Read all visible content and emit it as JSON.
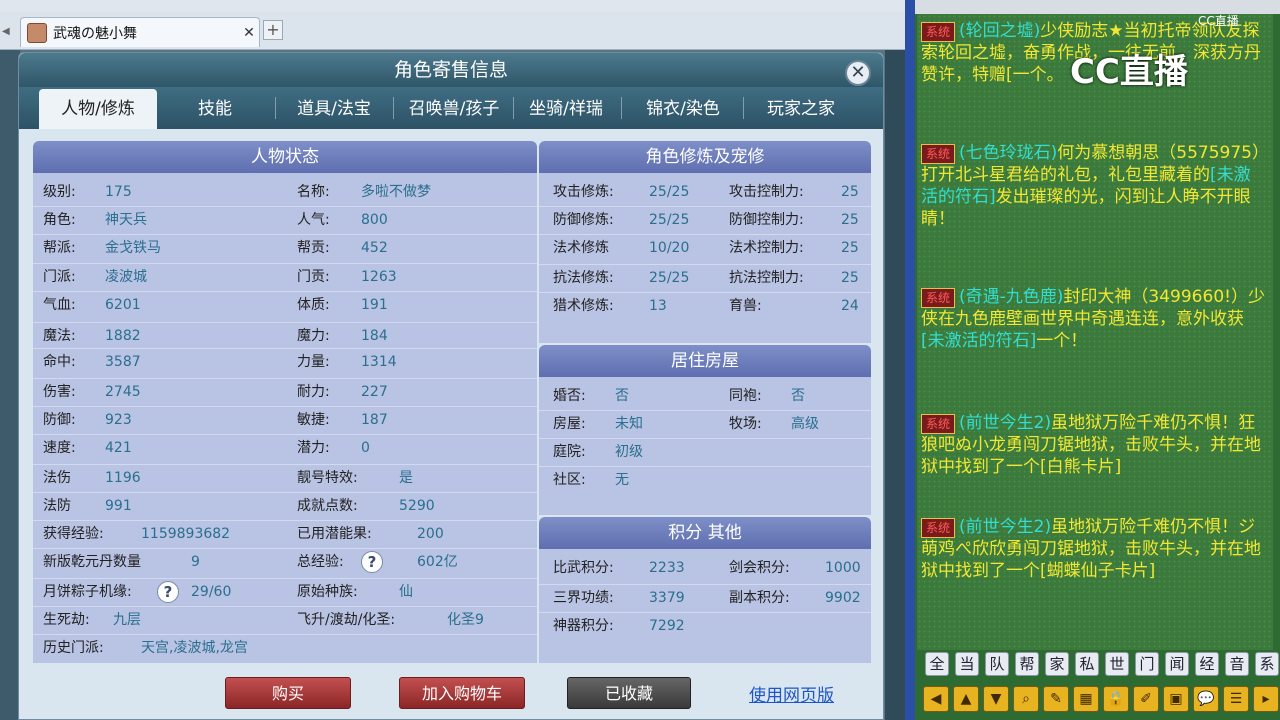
{
  "browser": {
    "tab_title": "武魂の魅小舞",
    "tab_close": "✕",
    "tab_add": "+"
  },
  "dialog": {
    "title": "角色寄售信息",
    "close": "✕",
    "tabs": [
      "人物/修炼",
      "技能",
      "道具/法宝",
      "召唤兽/孩子",
      "坐骑/祥瑞",
      "锦衣/染色",
      "玩家之家"
    ],
    "active_tab": "人物/修炼"
  },
  "status": {
    "header": "人物状态",
    "left": [
      {
        "label": "级别:",
        "value": "175"
      },
      {
        "label": "角色:",
        "value": "神天兵"
      },
      {
        "label": "帮派:",
        "value": "金戈铁马"
      },
      {
        "label": "门派:",
        "value": "凌波城"
      },
      {
        "label": "气血:",
        "value": "6201"
      },
      {
        "label": "魔法:",
        "value": "1882"
      },
      {
        "label": "命中:",
        "value": "3587"
      },
      {
        "label": "伤害:",
        "value": "2745"
      },
      {
        "label": "防御:",
        "value": "923"
      },
      {
        "label": "速度:",
        "value": "421"
      },
      {
        "label": "法伤",
        "value": "1196"
      },
      {
        "label": "法防",
        "value": "991"
      },
      {
        "label": "获得经验:",
        "value": "1159893682"
      },
      {
        "label": "新版乾元丹数量",
        "value": "9"
      },
      {
        "label": "月饼粽子机缘:",
        "value": "29/60"
      },
      {
        "label": "生死劫:",
        "value": "九层"
      },
      {
        "label": "历史门派:",
        "value": "天宫,凌波城,龙宫"
      }
    ],
    "right": [
      {
        "label": "名称:",
        "value": "多啦不做梦"
      },
      {
        "label": "人气:",
        "value": "800"
      },
      {
        "label": "帮贡:",
        "value": "452"
      },
      {
        "label": "门贡:",
        "value": "1263"
      },
      {
        "label": "体质:",
        "value": "191"
      },
      {
        "label": "魔力:",
        "value": "184"
      },
      {
        "label": "力量:",
        "value": "1314"
      },
      {
        "label": "耐力:",
        "value": "227"
      },
      {
        "label": "敏捷:",
        "value": "187"
      },
      {
        "label": "潜力:",
        "value": "0"
      },
      {
        "label": "靓号特效:",
        "value": "是"
      },
      {
        "label": "成就点数:",
        "value": "5290"
      },
      {
        "label": "已用潜能果:",
        "value": "200"
      },
      {
        "label": "总经验:",
        "value": "602亿"
      },
      {
        "label": "原始种族:",
        "value": "仙"
      },
      {
        "label": "飞升/渡劫/化圣:",
        "value": "化圣9"
      }
    ],
    "help": "?"
  },
  "cultivation": {
    "header": "角色修炼及宠修",
    "rows": [
      {
        "l1": "攻击修炼:",
        "v1": "25/25",
        "l2": "攻击控制力:",
        "v2": "25"
      },
      {
        "l1": "防御修炼:",
        "v1": "25/25",
        "l2": "防御控制力:",
        "v2": "25"
      },
      {
        "l1": "法术修炼",
        "v1": "10/20",
        "l2": "法术控制力:",
        "v2": "25"
      },
      {
        "l1": "抗法修炼:",
        "v1": "25/25",
        "l2": "抗法控制力:",
        "v2": "25"
      },
      {
        "l1": "猎术修炼:",
        "v1": "13",
        "l2": "育兽:",
        "v2": "24"
      }
    ]
  },
  "housing": {
    "header": "居住房屋",
    "rows": [
      {
        "l1": "婚否:",
        "v1": "否",
        "l2": "同袍:",
        "v2": "否"
      },
      {
        "l1": "房屋:",
        "v1": "未知",
        "l2": "牧场:",
        "v2": "高级"
      },
      {
        "l1": "庭院:",
        "v1": "初级",
        "l2": "",
        "v2": ""
      },
      {
        "l1": "社区:",
        "v1": "无",
        "l2": "",
        "v2": ""
      }
    ]
  },
  "points": {
    "header": "积分 其他",
    "rows": [
      {
        "l1": "比武积分:",
        "v1": "2233",
        "l2": "剑会积分:",
        "v2": "1000"
      },
      {
        "l1": "三界功绩:",
        "v1": "3379",
        "l2": "副本积分:",
        "v2": "9902"
      },
      {
        "l1": "神器积分:",
        "v1": "7292",
        "l2": "",
        "v2": ""
      }
    ]
  },
  "buttons": {
    "buy": "购买",
    "cart": "加入购物车",
    "fav": "已收藏",
    "web": "使用网页版"
  },
  "chat": {
    "logo": "CC直播",
    "logo_small": "CC直播",
    "sys": "系统",
    "messages": [
      {
        "a": "(轮回之墟)",
        "b": "少侠励志★当初托帝领队友探索轮回之墟，奋勇作战，一往无前，深获方丹赞许，特赠[",
        "c": "一个。"
      },
      {
        "a": "(七色玲珑石)",
        "b": "何为慕想朝思（5575975）打开北斗星君给的礼包，礼包里藏着的",
        "c": "[未激活的符石]",
        "d": "发出璀璨的光，闪到让人睁不开眼睛！"
      },
      {
        "a": "(奇遇-九色鹿)",
        "b": "封印大神（3499660!）少侠在九色鹿壁画世界中奇遇连连，意外收获",
        "c": "[未激活的符石]",
        "d": "一个！"
      },
      {
        "a": "(前世今生2)",
        "b": "虽地狱万险千难仍不惧！狂狼吧ぬ小龙勇闯刀锯地狱，击败牛头，并在地狱中找到了一个",
        "c": "[白熊卡片]"
      },
      {
        "a": "(前世今生2)",
        "b": "虽地狱万险千难仍不惧！ジ萌鸡ぺ欣欣勇闯刀锯地狱，击败牛头，并在地狱中找到了一个",
        "c": "[蝴蝶仙子卡片]"
      }
    ],
    "channels": [
      "全",
      "当",
      "队",
      "帮",
      "家",
      "私",
      "世",
      "门",
      "闻",
      "经",
      "音",
      "系"
    ]
  }
}
